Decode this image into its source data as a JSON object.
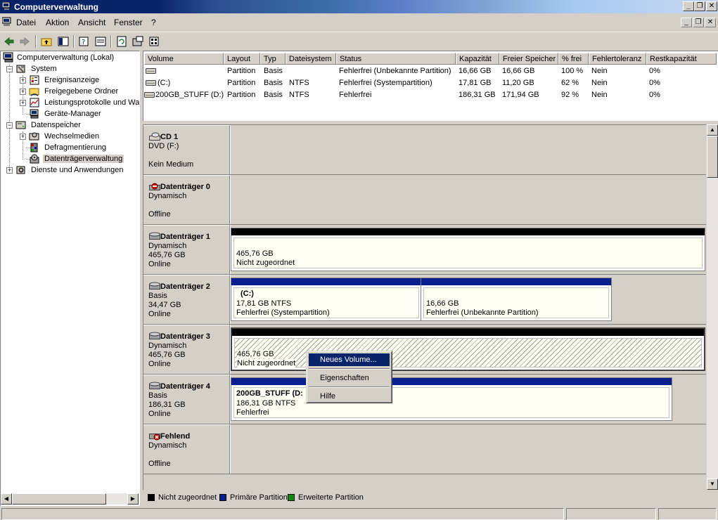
{
  "window": {
    "title": "Computerverwaltung"
  },
  "menubar": {
    "items": [
      {
        "label": "Datei"
      },
      {
        "label": "Aktion"
      },
      {
        "label": "Ansicht"
      },
      {
        "label": "Fenster"
      },
      {
        "label": "?"
      }
    ]
  },
  "toolbar": {
    "buttons": [
      "back-arrow-icon",
      "forward-arrow-icon",
      "folder-up-icon",
      "show-hide-tree-icon",
      "help-icon",
      "properties-icon",
      "refresh-icon",
      "export-list-icon",
      "help-book-icon"
    ]
  },
  "tree": {
    "root": "Computerverwaltung (Lokal)",
    "items": [
      {
        "label": "System"
      },
      {
        "label": "Ereignisanzeige"
      },
      {
        "label": "Freigegebene Ordner"
      },
      {
        "label": "Leistungsprotokolle und War"
      },
      {
        "label": "Geräte-Manager"
      },
      {
        "label": "Datenspeicher"
      },
      {
        "label": "Wechselmedien"
      },
      {
        "label": "Defragmentierung"
      },
      {
        "label": "Datenträgerverwaltung"
      },
      {
        "label": "Dienste und Anwendungen"
      }
    ]
  },
  "volumes": {
    "columns": [
      "Volume",
      "Layout",
      "Typ",
      "Dateisystem",
      "Status",
      "Kapazität",
      "Freier Speicher",
      "% frei",
      "Fehlertoleranz",
      "Restkapazität"
    ],
    "rows": [
      {
        "volume": "",
        "layout": "Partition",
        "typ": "Basis",
        "fs": "",
        "status": "Fehlerfrei (Unbekannte Partition)",
        "cap": "16,66 GB",
        "free": "16,66 GB",
        "pct": "100 %",
        "ft": "Nein",
        "rest": "0%"
      },
      {
        "volume": "(C:)",
        "layout": "Partition",
        "typ": "Basis",
        "fs": "NTFS",
        "status": "Fehlerfrei (Systempartition)",
        "cap": "17,81 GB",
        "free": "11,20 GB",
        "pct": "62 %",
        "ft": "Nein",
        "rest": "0%"
      },
      {
        "volume": "200GB_STUFF (D:)",
        "layout": "Partition",
        "typ": "Basis",
        "fs": "NTFS",
        "status": "Fehlerfrei",
        "cap": "186,31 GB",
        "free": "171,94 GB",
        "pct": "92 %",
        "ft": "Nein",
        "rest": "0%"
      }
    ]
  },
  "disks": [
    {
      "name": "CD 1",
      "line1": "DVD (F:)",
      "line2": "",
      "line3": "Kein Medium"
    },
    {
      "name": "Datenträger 0",
      "line1": "Dynamisch",
      "line2": "",
      "line3": "Offline"
    },
    {
      "name": "Datenträger 1",
      "line1": "Dynamisch",
      "line2": "465,76 GB",
      "line3": "Online",
      "partitions": [
        {
          "title": "",
          "size": "465,76 GB",
          "status": "Nicht zugeordnet"
        }
      ]
    },
    {
      "name": "Datenträger 2",
      "line1": "Basis",
      "line2": "34,47 GB",
      "line3": "Online",
      "partitions": [
        {
          "title": "(C:)",
          "size": "17,81 GB NTFS",
          "status": "Fehlerfrei (Systempartition)"
        },
        {
          "title": "",
          "size": "16,66 GB",
          "status": "Fehlerfrei (Unbekannte Partition)"
        }
      ]
    },
    {
      "name": "Datenträger 3",
      "line1": "Dynamisch",
      "line2": "465,76 GB",
      "line3": "Online",
      "partitions": [
        {
          "title": "",
          "size": "465,76 GB",
          "status": "Nicht zugeordnet"
        }
      ]
    },
    {
      "name": "Datenträger 4",
      "line1": "Basis",
      "line2": "186,31 GB",
      "line3": "Online",
      "partitions": [
        {
          "title": "200GB_STUFF  (D:",
          "size": "186,31 GB NTFS",
          "status": "Fehlerfrei"
        }
      ]
    },
    {
      "name": "Fehlend",
      "line1": "Dynamisch",
      "line2": "",
      "line3": "Offline"
    }
  ],
  "legend": [
    {
      "label": "Nicht zugeordnet",
      "color": "#000000"
    },
    {
      "label": "Primäre Partition",
      "color": "#0a1f8f"
    },
    {
      "label": "Erweiterte Partition",
      "color": "#128812"
    }
  ],
  "context_menu": {
    "items": [
      "Neues Volume...",
      "Eigenschaften",
      "Hilfe"
    ]
  },
  "colors": {
    "title_gradient_start": "#0a246a",
    "primary_partition": "#0a1f8f",
    "unallocated": "#000000",
    "highlight": "#0a246a"
  }
}
